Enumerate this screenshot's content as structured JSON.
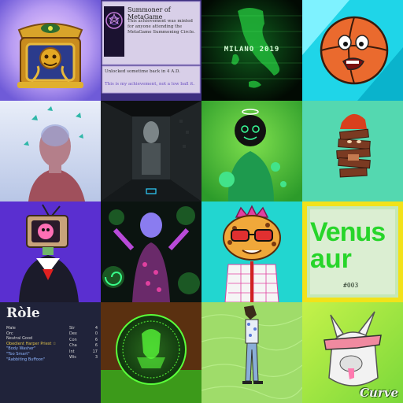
{
  "gallery": {
    "tile2": {
      "title": "Summoner of MetaGame",
      "description": "This achievement was minted for anyone attending the MetaGame Summoning Circle.",
      "unlocked": "Unlocked sometime back in 4 A.D.",
      "rarity": "This is my achievement, not a low ball it."
    },
    "tile3": {
      "caption": "MILANO 2019"
    },
    "tile12": {
      "title": "Venus",
      "title2": "aur",
      "number": "#003"
    },
    "tile13": {
      "title": "Ròle",
      "lines": [
        "Male",
        "Orc",
        "Neutral Good",
        "Obedient Harper Priest ☆",
        "\"Body Washer\"",
        "\"Too Smart\"",
        "\"Rabbiting Buffoon\""
      ],
      "stats": [
        {
          "label": "Str",
          "value": "4"
        },
        {
          "label": "Dex",
          "value": "0"
        },
        {
          "label": "Con",
          "value": "6"
        },
        {
          "label": "Cha",
          "value": "6"
        },
        {
          "label": "Int",
          "value": "17"
        },
        {
          "label": "Wis",
          "value": "3"
        }
      ]
    },
    "tile16": {
      "signature": "Curve"
    }
  },
  "colors": {
    "tile3_green": "#2df04a",
    "tile12_green": "#27d52a",
    "tile12_border": "#f2e21a",
    "tile13_link": "#8fb6ff",
    "tile13_gold": "#e0c24a"
  }
}
